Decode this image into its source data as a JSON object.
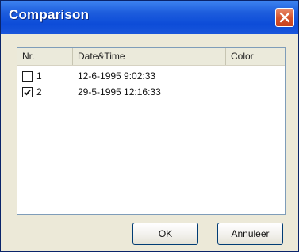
{
  "window": {
    "title": "Comparison"
  },
  "list": {
    "columns": [
      "Nr.",
      "Date&Time",
      "Color"
    ],
    "rows": [
      {
        "nr": "1",
        "datetime": "12-6-1995 9:02:33",
        "checked": false
      },
      {
        "nr": "2",
        "datetime": "29-5-1995 12:16:33",
        "checked": true
      }
    ]
  },
  "buttons": {
    "ok_label": "OK",
    "cancel_label": "Annuleer"
  },
  "colors": {
    "titlebar": "#1d5ddd",
    "close_button": "#d5522b",
    "dialog_background": "#ece9d8"
  },
  "icons": {
    "close": "close-icon",
    "check": "checkmark-icon"
  }
}
